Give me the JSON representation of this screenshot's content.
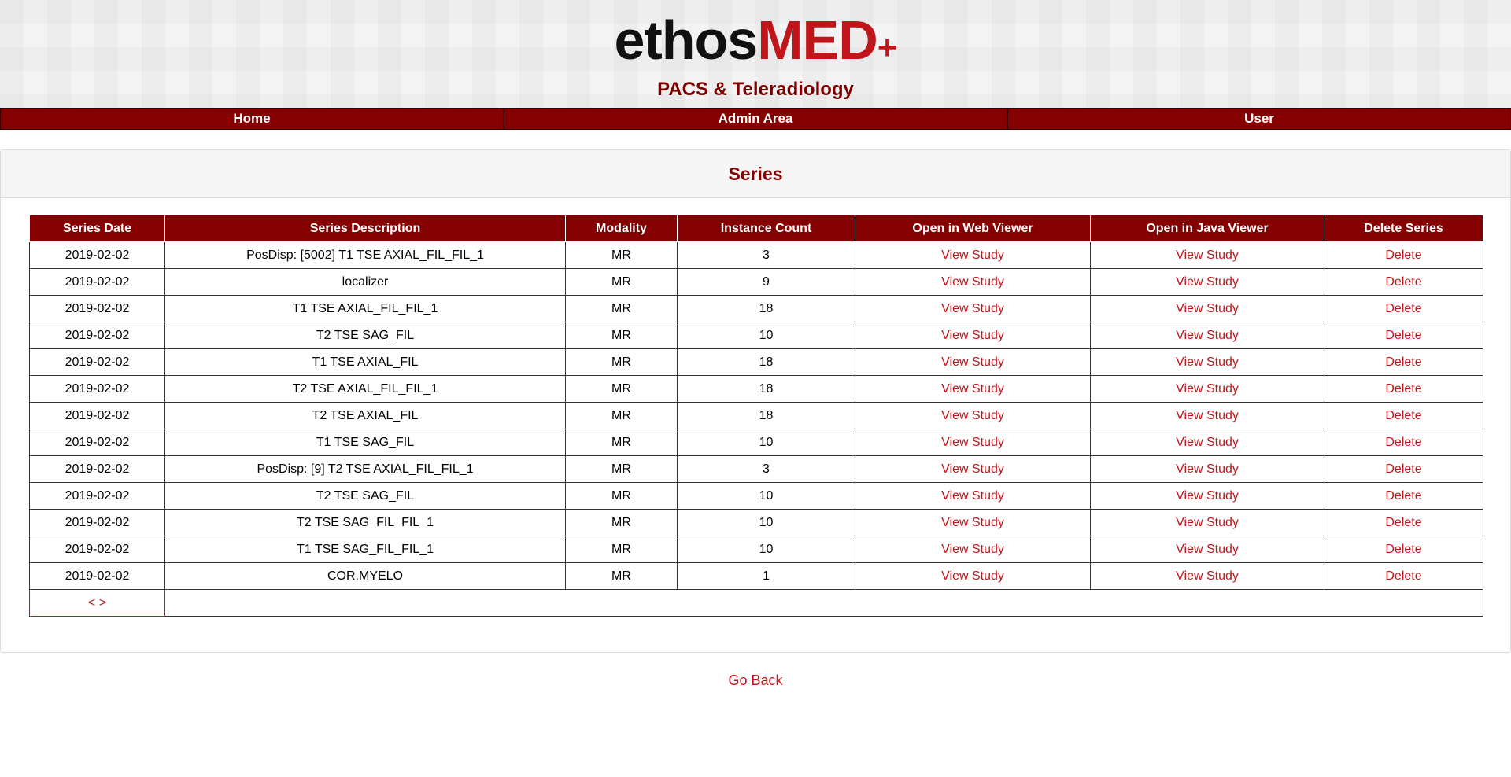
{
  "logo": {
    "part1": "ethos",
    "part2": "MED",
    "plus": "+",
    "tagline": "PACS & Teleradiology"
  },
  "nav": [
    {
      "label": "Home"
    },
    {
      "label": "Admin Area"
    },
    {
      "label": "User"
    }
  ],
  "panel": {
    "title": "Series"
  },
  "table": {
    "headers": [
      "Series Date",
      "Series Description",
      "Modality",
      "Instance Count",
      "Open in Web Viewer",
      "Open in Java Viewer",
      "Delete Series"
    ],
    "rows": [
      {
        "date": "2019-02-02",
        "desc": "PosDisp: [5002] T1 TSE AXIAL_FIL_FIL_1",
        "modality": "MR",
        "count": "3",
        "web": "View Study",
        "java": "View Study",
        "del": "Delete"
      },
      {
        "date": "2019-02-02",
        "desc": "localizer",
        "modality": "MR",
        "count": "9",
        "web": "View Study",
        "java": "View Study",
        "del": "Delete"
      },
      {
        "date": "2019-02-02",
        "desc": "T1 TSE AXIAL_FIL_FIL_1",
        "modality": "MR",
        "count": "18",
        "web": "View Study",
        "java": "View Study",
        "del": "Delete"
      },
      {
        "date": "2019-02-02",
        "desc": "T2 TSE SAG_FIL",
        "modality": "MR",
        "count": "10",
        "web": "View Study",
        "java": "View Study",
        "del": "Delete"
      },
      {
        "date": "2019-02-02",
        "desc": "T1 TSE AXIAL_FIL",
        "modality": "MR",
        "count": "18",
        "web": "View Study",
        "java": "View Study",
        "del": "Delete"
      },
      {
        "date": "2019-02-02",
        "desc": "T2 TSE AXIAL_FIL_FIL_1",
        "modality": "MR",
        "count": "18",
        "web": "View Study",
        "java": "View Study",
        "del": "Delete"
      },
      {
        "date": "2019-02-02",
        "desc": "T2 TSE AXIAL_FIL",
        "modality": "MR",
        "count": "18",
        "web": "View Study",
        "java": "View Study",
        "del": "Delete"
      },
      {
        "date": "2019-02-02",
        "desc": "T1 TSE SAG_FIL",
        "modality": "MR",
        "count": "10",
        "web": "View Study",
        "java": "View Study",
        "del": "Delete"
      },
      {
        "date": "2019-02-02",
        "desc": "PosDisp: [9] T2 TSE AXIAL_FIL_FIL_1",
        "modality": "MR",
        "count": "3",
        "web": "View Study",
        "java": "View Study",
        "del": "Delete"
      },
      {
        "date": "2019-02-02",
        "desc": "T2 TSE SAG_FIL",
        "modality": "MR",
        "count": "10",
        "web": "View Study",
        "java": "View Study",
        "del": "Delete"
      },
      {
        "date": "2019-02-02",
        "desc": "T2 TSE SAG_FIL_FIL_1",
        "modality": "MR",
        "count": "10",
        "web": "View Study",
        "java": "View Study",
        "del": "Delete"
      },
      {
        "date": "2019-02-02",
        "desc": "T1 TSE SAG_FIL_FIL_1",
        "modality": "MR",
        "count": "10",
        "web": "View Study",
        "java": "View Study",
        "del": "Delete"
      },
      {
        "date": "2019-02-02",
        "desc": "COR.MYELO",
        "modality": "MR",
        "count": "1",
        "web": "View Study",
        "java": "View Study",
        "del": "Delete"
      }
    ],
    "pager": {
      "prev": "<",
      "next": ">"
    }
  },
  "footer": {
    "go_back": "Go Back"
  },
  "colors": {
    "brand": "#850000",
    "link": "#c0161b"
  }
}
